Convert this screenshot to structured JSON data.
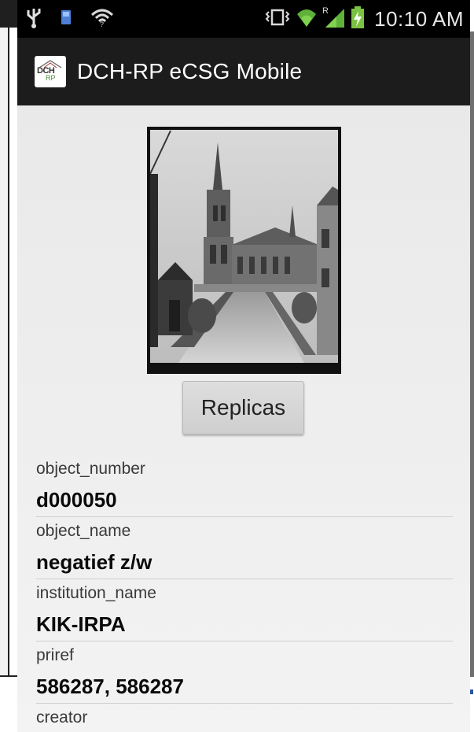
{
  "status_bar": {
    "time": "10:10 AM",
    "left_icons": [
      "usb-icon",
      "storage-icon",
      "wifi-hotspot-icon"
    ],
    "right_icons": [
      "vibrate-icon",
      "wifi-icon",
      "signal-icon",
      "battery-charging-icon"
    ],
    "roaming_indicator": "R"
  },
  "action_bar": {
    "logo_text_top": "DCH",
    "logo_text_bottom": "RP",
    "title": "DCH-RP eCSG Mobile"
  },
  "replicas_button": {
    "label": "Replicas"
  },
  "fields": [
    {
      "label": "object_number",
      "value": "d000050"
    },
    {
      "label": "object_name",
      "value": "negatief z/w"
    },
    {
      "label": "institution_name",
      "value": "KIK-IRPA"
    },
    {
      "label": "priref",
      "value": "586287, 586287"
    },
    {
      "label": "creator",
      "value": ""
    }
  ],
  "colors": {
    "status_bar": "#000000",
    "action_bar": "#1c1c1c",
    "content_bg": "#ececec",
    "battery_green": "#7cc242",
    "signal_green": "#5fb13a"
  }
}
